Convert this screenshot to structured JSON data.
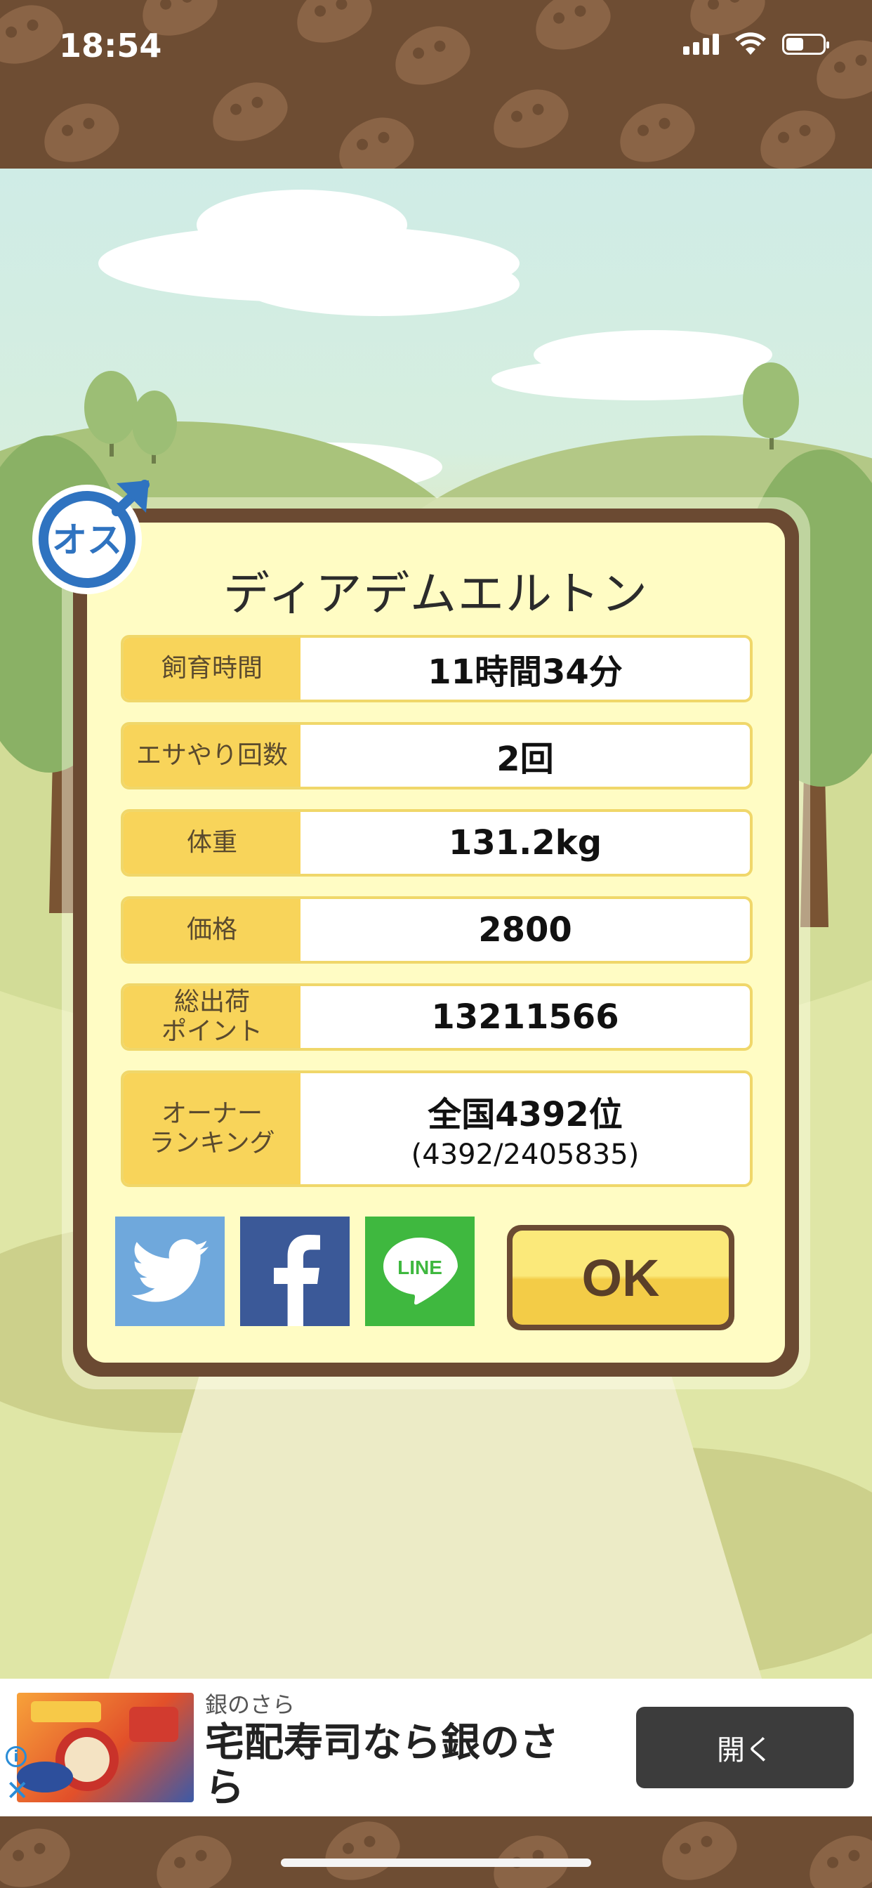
{
  "status_bar": {
    "time": "18:54"
  },
  "dialog": {
    "title": "ディアデムエルトン",
    "gender": "オス",
    "rows": [
      {
        "label": "飼育時間",
        "value": "11時間34分"
      },
      {
        "label": "エサやり回数",
        "value": "2回"
      },
      {
        "label": "体重",
        "value": "131.2kg"
      },
      {
        "label": "価格",
        "value": "2800"
      },
      {
        "label": "総出荷\nポイント",
        "value": "13211566"
      },
      {
        "label": "オーナー\nランキング",
        "value": "全国4392位",
        "sub": "(4392/2405835)"
      }
    ],
    "share": {
      "twitter_icon": "twitter-bird",
      "facebook_icon": "facebook-f",
      "line_text": "LINE"
    },
    "ok_label": "OK"
  },
  "ad": {
    "sponsor": "銀のさら",
    "title": "宅配寿司なら銀のさら",
    "open_label": "開く",
    "info_glyph": "i",
    "close_glyph": "✕"
  },
  "colors": {
    "brown": "#6b4a32",
    "label_yellow": "#f8d45a",
    "panel": "#fffcc4",
    "twitter": "#6fa8dc",
    "facebook": "#3b5998",
    "line": "#3fb83f"
  }
}
